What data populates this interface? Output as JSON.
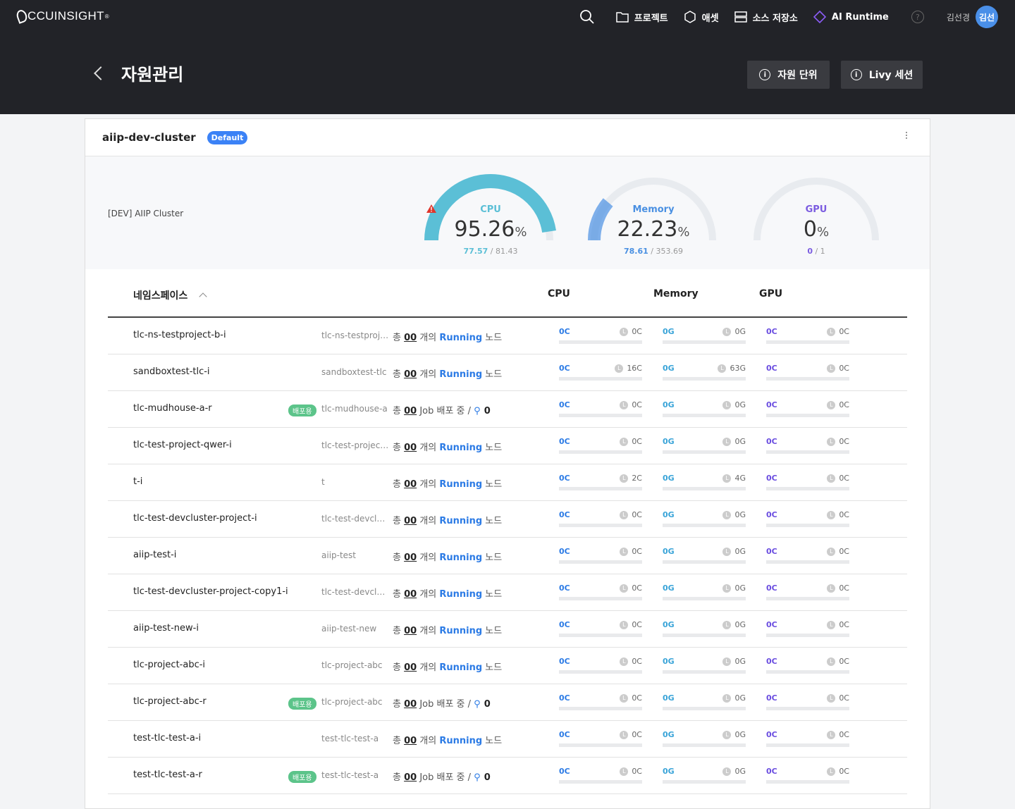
{
  "app": {
    "logo": "CCUINSIGHT",
    "logo_mark": "®"
  },
  "nav": {
    "projects": "프로젝트",
    "assets": "애셋",
    "source_storage": "소스 저장소",
    "ai_runtime": "AI Runtime",
    "help": "?",
    "user_name": "김선경",
    "avatar_text": "김선"
  },
  "page": {
    "title": "자원관리",
    "btn_resource_unit": "자원 단위",
    "btn_livy": "Livy 세션"
  },
  "cluster": {
    "name": "aiip-dev-cluster",
    "badge": "Default",
    "description": "[DEV] AIIP Cluster"
  },
  "gauges": {
    "cpu": {
      "label": "CPU",
      "value": "95.26",
      "unit": "%",
      "used": "77.57",
      "total": "81.43",
      "sep": " / ",
      "fraction": 0.9526,
      "color": "#5bbfd6"
    },
    "memory": {
      "label": "Memory",
      "value": "22.23",
      "unit": "%",
      "used": "78.61",
      "total": "353.69",
      "sep": " / ",
      "fraction": 0.2223,
      "color": "#4a90e2"
    },
    "gpu": {
      "label": "GPU",
      "value": "0",
      "unit": "%",
      "used": "0",
      "total": "1",
      "sep": " / ",
      "fraction": 0,
      "color": "#7b5ce0"
    }
  },
  "table": {
    "headers": {
      "namespace": "네임스페이스",
      "cpu": "CPU",
      "memory": "Memory",
      "gpu": "GPU"
    },
    "text": {
      "total": "총 ",
      "running_suffix": " 개의 ",
      "running": "Running",
      "node": " 노드",
      "job": " Job 배포 중 / ",
      "deploy_tag": "배포용"
    },
    "rows": [
      {
        "name": "tlc-ns-testproject-b-i",
        "alias": "tlc-ns-testproje...",
        "count": "00",
        "type": "running",
        "cpu": [
          "0C",
          "0C"
        ],
        "mem": [
          "0G",
          "0G"
        ],
        "gpu": [
          "0C",
          "0C"
        ]
      },
      {
        "name": "sandboxtest-tlc-i",
        "alias": "sandboxtest-tlc",
        "count": "00",
        "type": "running",
        "cpu": [
          "0C",
          "16C"
        ],
        "mem": [
          "0G",
          "63G"
        ],
        "gpu": [
          "0C",
          "0C"
        ]
      },
      {
        "name": "tlc-mudhouse-a-r",
        "alias": "tlc-mudhouse-a",
        "count": "00",
        "type": "job",
        "jobs": "0",
        "cpu": [
          "0C",
          "0C"
        ],
        "mem": [
          "0G",
          "0G"
        ],
        "gpu": [
          "0C",
          "0C"
        ]
      },
      {
        "name": "tlc-test-project-qwer-i",
        "alias": "tlc-test-project-...",
        "count": "00",
        "type": "running",
        "cpu": [
          "0C",
          "0C"
        ],
        "mem": [
          "0G",
          "0G"
        ],
        "gpu": [
          "0C",
          "0C"
        ]
      },
      {
        "name": "t-i",
        "alias": "t",
        "count": "00",
        "type": "running",
        "cpu": [
          "0C",
          "2C"
        ],
        "mem": [
          "0G",
          "4G"
        ],
        "gpu": [
          "0C",
          "0C"
        ]
      },
      {
        "name": "tlc-test-devcluster-project-i",
        "alias": "tlc-test-devclus...",
        "count": "00",
        "type": "running",
        "cpu": [
          "0C",
          "0C"
        ],
        "mem": [
          "0G",
          "0G"
        ],
        "gpu": [
          "0C",
          "0C"
        ]
      },
      {
        "name": "aiip-test-i",
        "alias": "aiip-test",
        "count": "00",
        "type": "running",
        "cpu": [
          "0C",
          "0C"
        ],
        "mem": [
          "0G",
          "0G"
        ],
        "gpu": [
          "0C",
          "0C"
        ]
      },
      {
        "name": "tlc-test-devcluster-project-copy1-i",
        "alias": "tlc-test-devclus...",
        "count": "00",
        "type": "running",
        "cpu": [
          "0C",
          "0C"
        ],
        "mem": [
          "0G",
          "0G"
        ],
        "gpu": [
          "0C",
          "0C"
        ]
      },
      {
        "name": "aiip-test-new-i",
        "alias": "aiip-test-new",
        "count": "00",
        "type": "running",
        "cpu": [
          "0C",
          "0C"
        ],
        "mem": [
          "0G",
          "0G"
        ],
        "gpu": [
          "0C",
          "0C"
        ]
      },
      {
        "name": "tlc-project-abc-i",
        "alias": "tlc-project-abc",
        "count": "00",
        "type": "running",
        "cpu": [
          "0C",
          "0C"
        ],
        "mem": [
          "0G",
          "0G"
        ],
        "gpu": [
          "0C",
          "0C"
        ]
      },
      {
        "name": "tlc-project-abc-r",
        "alias": "tlc-project-abc",
        "count": "00",
        "type": "job",
        "jobs": "0",
        "cpu": [
          "0C",
          "0C"
        ],
        "mem": [
          "0G",
          "0G"
        ],
        "gpu": [
          "0C",
          "0C"
        ]
      },
      {
        "name": "test-tlc-test-a-i",
        "alias": "test-tlc-test-a",
        "count": "00",
        "type": "running",
        "cpu": [
          "0C",
          "0C"
        ],
        "mem": [
          "0G",
          "0G"
        ],
        "gpu": [
          "0C",
          "0C"
        ]
      },
      {
        "name": "test-tlc-test-a-r",
        "alias": "test-tlc-test-a",
        "count": "00",
        "type": "job",
        "jobs": "0",
        "cpu": [
          "0C",
          "0C"
        ],
        "mem": [
          "0G",
          "0G"
        ],
        "gpu": [
          "0C",
          "0C"
        ]
      }
    ]
  },
  "colors": {
    "cpu": "#2c7be5",
    "memory": "#3aa4d8",
    "gpu": "#6a4de0",
    "warning": "#e0352b"
  }
}
